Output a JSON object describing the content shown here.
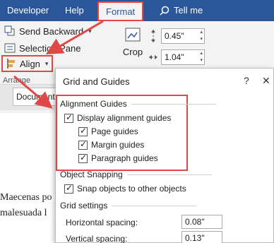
{
  "ribbon": {
    "tabs": [
      "Developer",
      "Help",
      "Format"
    ],
    "tell_me": "Tell me",
    "send_backward": "Send Backward",
    "selection_pane": "Selection Pane",
    "align": "Align",
    "arrange": "Arrange",
    "crop": "Crop",
    "height": "0.45\"",
    "width": "1.04\""
  },
  "doc": {
    "style_box": "Document",
    "line1": "Maecenas po",
    "line2": "malesuada l"
  },
  "dialog": {
    "title": "Grid and Guides",
    "help": "?",
    "close": "✕",
    "alignment_guides": "Alignment Guides",
    "display_alignment_guides": "Display alignment guides",
    "page_guides": "Page guides",
    "margin_guides": "Margin guides",
    "paragraph_guides": "Paragraph guides",
    "object_snapping": "Object Snapping",
    "snap_objects": "Snap objects to other objects",
    "grid_settings": "Grid settings",
    "horizontal_spacing": "Horizontal spacing:",
    "horizontal_value": "0.08\"",
    "vertical_spacing": "Vertical spacing:",
    "vertical_value": "0.13\""
  },
  "colors": {
    "ribbon_blue": "#2b579a",
    "callout_red": "#e04848"
  }
}
